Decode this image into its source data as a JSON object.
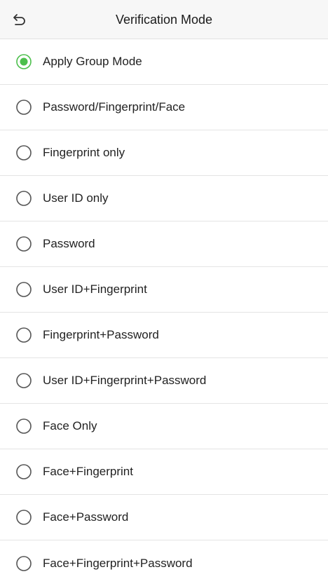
{
  "header": {
    "title": "Verification Mode",
    "back_icon": "back-arrow-icon"
  },
  "options": [
    {
      "label": "Apply Group Mode",
      "selected": true
    },
    {
      "label": "Password/Fingerprint/Face",
      "selected": false
    },
    {
      "label": "Fingerprint only",
      "selected": false
    },
    {
      "label": "User ID only",
      "selected": false
    },
    {
      "label": "Password",
      "selected": false
    },
    {
      "label": "User ID+Fingerprint",
      "selected": false
    },
    {
      "label": "Fingerprint+Password",
      "selected": false
    },
    {
      "label": "User ID+Fingerprint+Password",
      "selected": false
    },
    {
      "label": "Face Only",
      "selected": false
    },
    {
      "label": "Face+Fingerprint",
      "selected": false
    },
    {
      "label": "Face+Password",
      "selected": false
    },
    {
      "label": "Face+Fingerprint+Password",
      "selected": false
    }
  ],
  "colors": {
    "accent": "#4cbf4c",
    "radio_border": "#555555",
    "divider": "#e4e4e4",
    "header_bg": "#f7f7f7"
  }
}
